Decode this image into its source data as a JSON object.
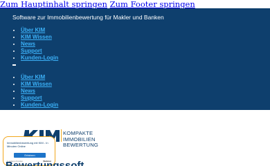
{
  "skip_links": {
    "main": "Zum Hauptinhalt springen",
    "footer": "Zum Footer springen"
  },
  "header": {
    "tagline": "Software zur Immobilienbewertung für Makler und Banken",
    "nav_primary": [
      {
        "label": "Über KIM"
      },
      {
        "label": "KIM Wissen"
      },
      {
        "label": "News"
      },
      {
        "label": "Support"
      },
      {
        "label": "Kunden-Login"
      }
    ],
    "menu_toggle_icon": "menu-toggle-icon",
    "nav_secondary": [
      {
        "label": "Über KIM"
      },
      {
        "label": "KIM Wissen"
      },
      {
        "label": "News"
      },
      {
        "label": "Support"
      },
      {
        "label": "Kunden-Login"
      }
    ]
  },
  "logo": {
    "wordmark": "KIM",
    "lines": [
      "KOMPAKTE",
      "IMMOBILIEN",
      "BEWERTUNG"
    ]
  },
  "badge": {
    "text": "Immobilienbewertung mit KIM - In Minuten Online",
    "button_label": "Erfahren",
    "footer_left": "1 anderen Kunden",
    "footer_right": "Webinar"
  },
  "main": {
    "heading": "Bewertungssoft"
  },
  "colors": {
    "header_bg": "#0e3f6d",
    "nav_link": "#3bb0f7",
    "badge_border": "#f2a71c",
    "button_bg": "#1d74c9"
  }
}
